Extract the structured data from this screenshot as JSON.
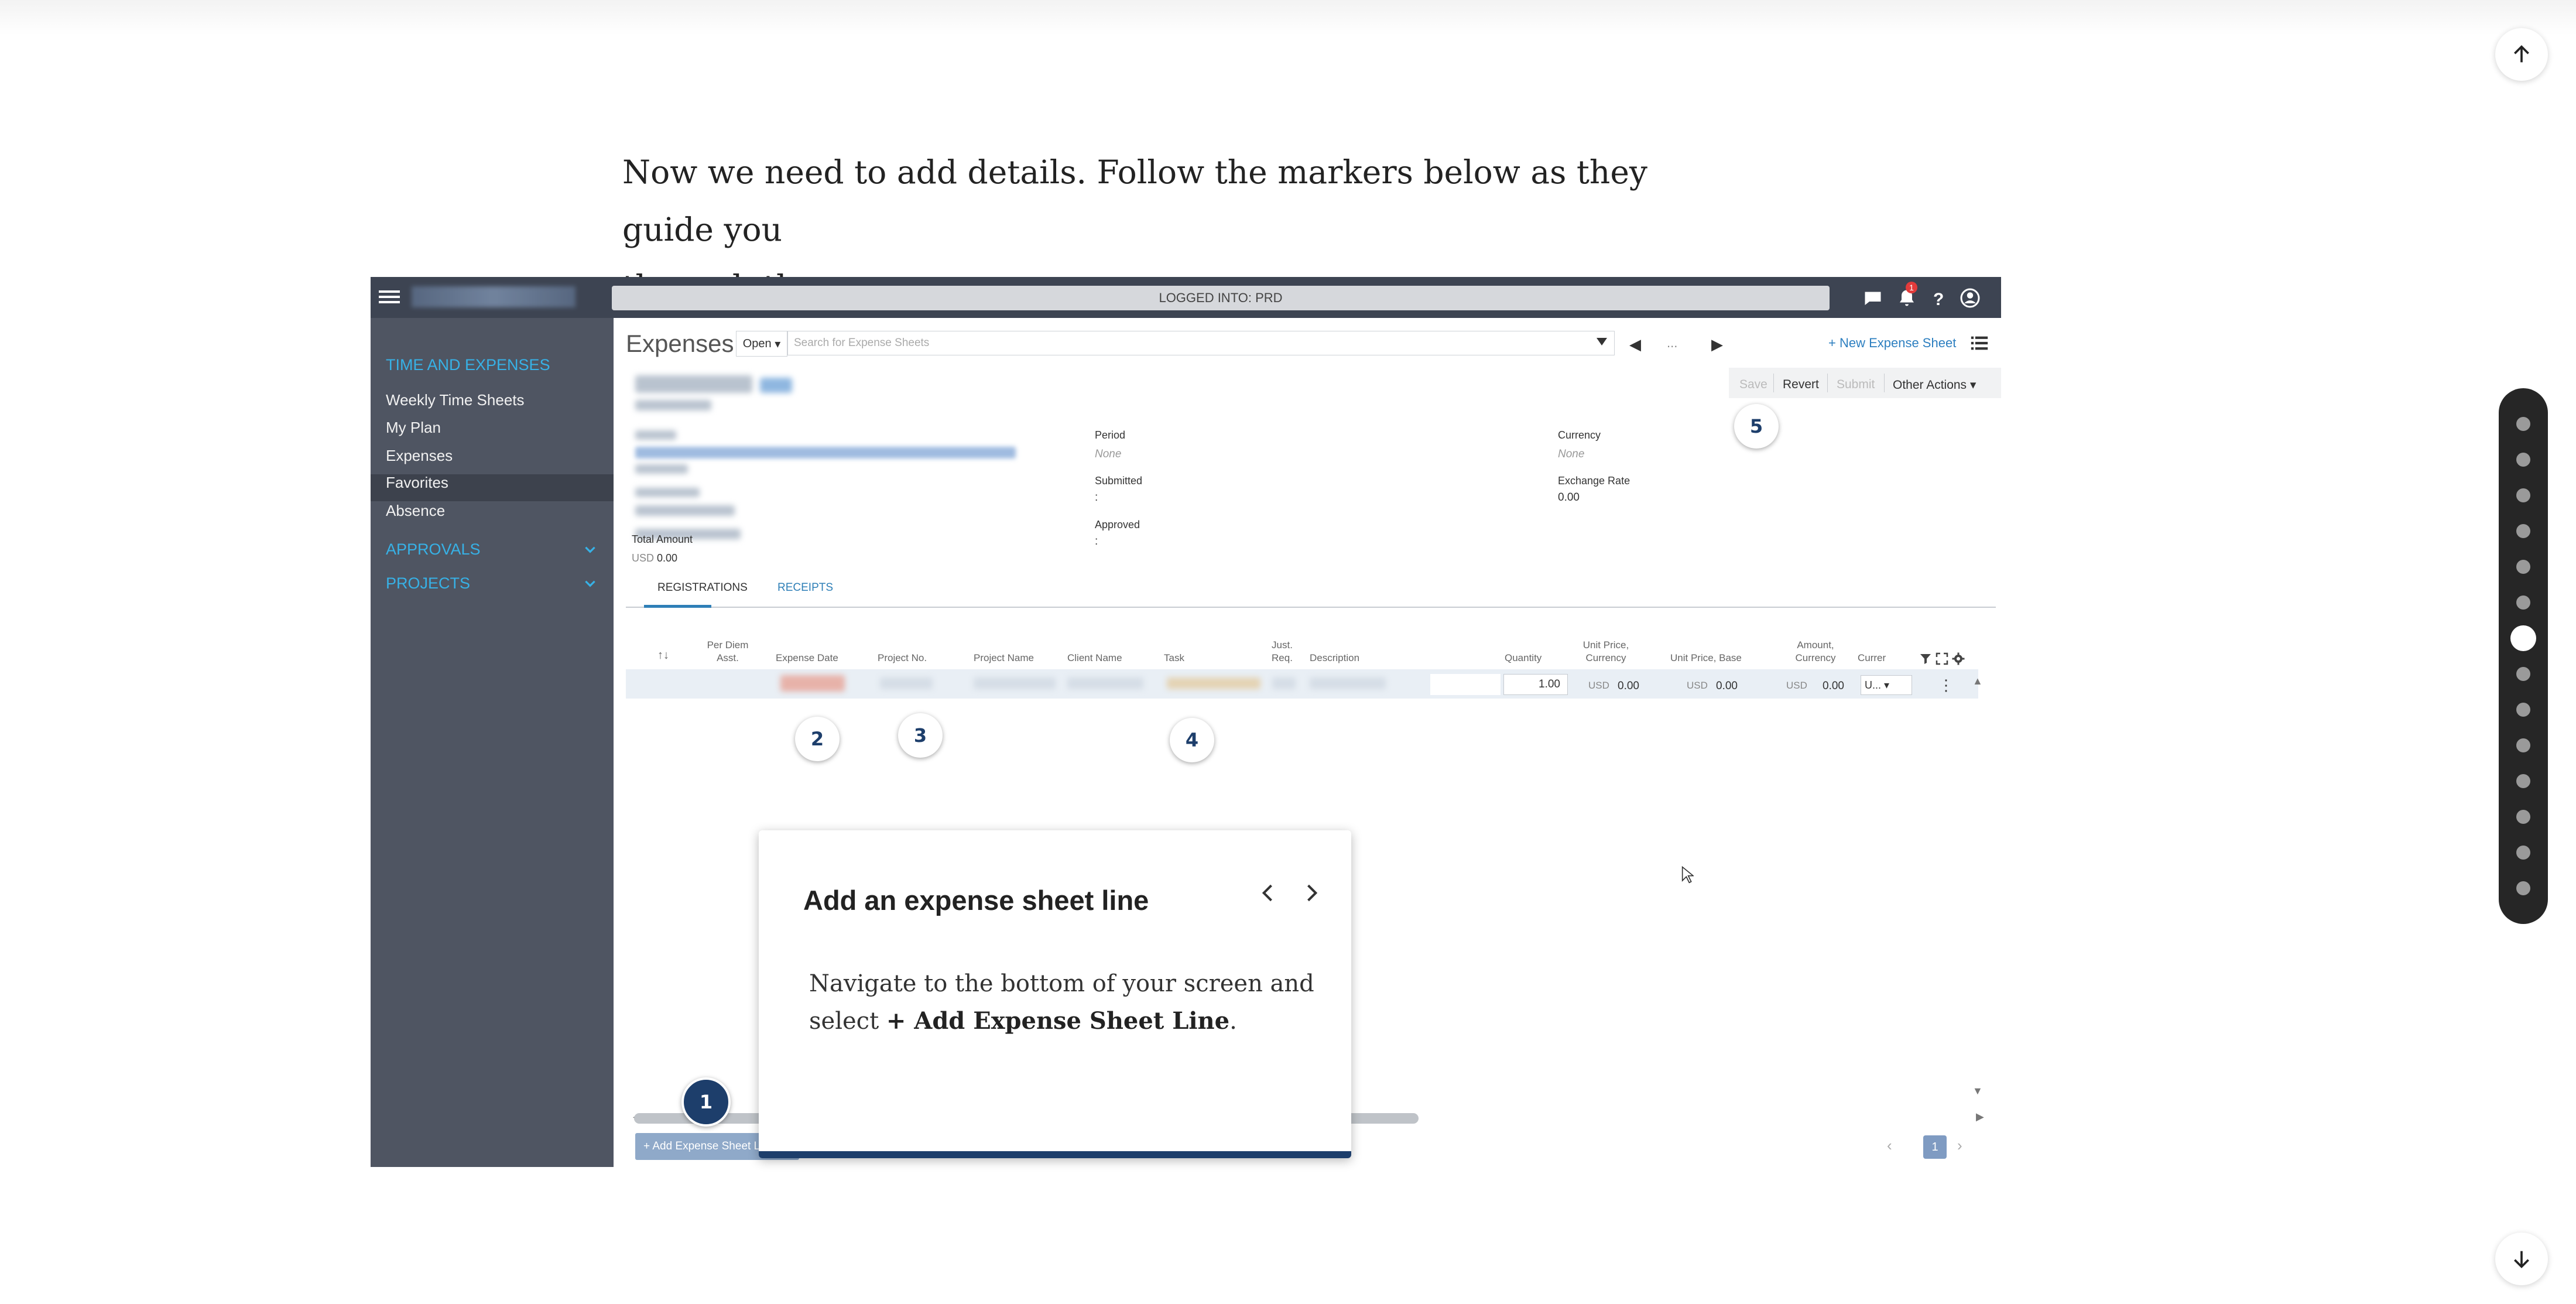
{
  "intro": {
    "line1": "Now we need to add details. Follow the markers below as they guide you",
    "line2": "through the process."
  },
  "page_nav": {
    "up_icon": "arrow-up-icon",
    "down_icon": "arrow-down-icon"
  },
  "progress": {
    "total_steps": 14,
    "current_step": 7
  },
  "app": {
    "logged_in": "LOGGED INTO: PRD",
    "notification_count": "1",
    "sidebar": {
      "section_time": "TIME AND EXPENSES",
      "items": [
        "Weekly Time Sheets",
        "My Plan",
        "Expenses",
        "Favorites",
        "Absence"
      ],
      "active_item": "Expenses",
      "section_approvals": "APPROVALS",
      "section_projects": "PROJECTS"
    },
    "header": {
      "title": "Expenses",
      "filter": "Open",
      "search_placeholder": "Search for Expense Sheets",
      "ellipsis": "...",
      "new_sheet": "+ New Expense Sheet"
    },
    "actions": {
      "save": "Save",
      "revert": "Revert",
      "submit": "Submit",
      "other": "Other Actions"
    },
    "fields": {
      "period_label": "Period",
      "period_value": "None",
      "submitted_label": "Submitted",
      "submitted_value": ":",
      "approved_label": "Approved",
      "approved_value": ":",
      "currency_label": "Currency",
      "currency_value": "None",
      "exchange_label": "Exchange Rate",
      "exchange_value": "0.00",
      "total_label": "Total Amount",
      "total_currency": "USD",
      "total_value": "0.00"
    },
    "tabs": [
      "REGISTRATIONS",
      "RECEIPTS"
    ],
    "table": {
      "headers": {
        "per_diem": "Per Diem Asst.",
        "expense_date": "Expense Date",
        "project_no": "Project No.",
        "project_name": "Project Name",
        "client_name": "Client Name",
        "task": "Task",
        "just_req": "Just. Req.",
        "description": "Description",
        "quantity": "Quantity",
        "unit_price_currency": "Unit Price, Currency",
        "unit_price_base": "Unit Price, Base",
        "amount_currency": "Amount, Currency",
        "currency": "Currer"
      },
      "row": {
        "quantity": "1.00",
        "unit_price_cur_code": "USD",
        "unit_price_cur": "0.00",
        "unit_price_base_code": "USD",
        "unit_price_base": "0.00",
        "amount_code": "USD",
        "amount": "0.00",
        "currency_sel": "U..."
      }
    },
    "bottom": {
      "add_line": "+ Add Expense Sheet Line",
      "page": "1"
    }
  },
  "markers": [
    "1",
    "2",
    "3",
    "4",
    "5"
  ],
  "tooltip": {
    "title": "Add an expense sheet line",
    "body_prefix": "Navigate to the bottom of your screen and select ",
    "body_bold": "+ Add Expense Sheet Line",
    "body_suffix": "."
  },
  "colors": {
    "accent": "#1d3e6b",
    "sidebar": "#4f5562",
    "link": "#37b1e6"
  }
}
